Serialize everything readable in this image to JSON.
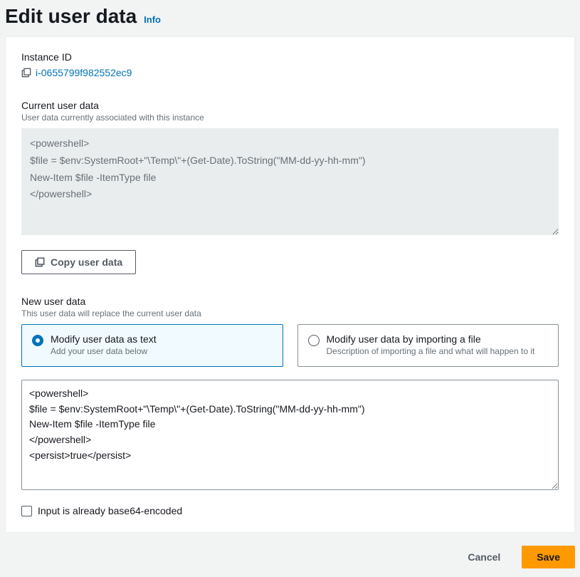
{
  "header": {
    "title": "Edit user data",
    "info_label": "Info"
  },
  "instance": {
    "label": "Instance ID",
    "id": "i-0655799f982552ec9"
  },
  "current": {
    "label": "Current user data",
    "desc": "User data currently associated with this instance",
    "value": "<powershell>\n$file = $env:SystemRoot+\"\\Temp\\\"+(Get-Date).ToString(\"MM-dd-yy-hh-mm\")\nNew-Item $file -ItemType file\n</powershell>",
    "copy_label": "Copy user data"
  },
  "new": {
    "label": "New user data",
    "desc": "This user data will replace the current user data",
    "options": [
      {
        "title": "Modify user data as text",
        "desc": "Add your user data below",
        "selected": true
      },
      {
        "title": "Modify user data by importing a file",
        "desc": "Description of importing a file and what will happen to it",
        "selected": false
      }
    ],
    "value": "<powershell>\n$file = $env:SystemRoot+\"\\Temp\\\"+(Get-Date).ToString(\"MM-dd-yy-hh-mm\")\nNew-Item $file -ItemType file\n</powershell>\n<persist>true</persist>"
  },
  "base64": {
    "label": "Input is already base64-encoded",
    "checked": false
  },
  "actions": {
    "cancel": "Cancel",
    "save": "Save"
  }
}
